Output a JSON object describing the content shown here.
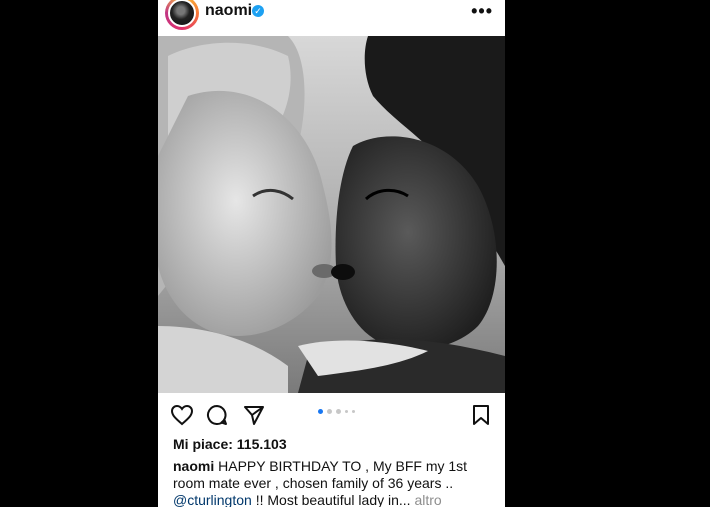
{
  "post": {
    "username": "naomi",
    "verified_icon": "verified-badge-icon",
    "more_label": "•••",
    "likes_text": "Mi piace: 115.103",
    "caption": {
      "username": "naomi",
      "text1": " HAPPY BIRTHDAY TO , My BFF  my 1st room mate ever , chosen family of 36 years .. ",
      "mention": "@cturlington",
      "text2": " !! Most beautiful lady in... ",
      "more": "altro"
    },
    "carousel": {
      "count": 5,
      "active_index": 0
    }
  },
  "colors": {
    "background": "#000000",
    "panel": "#ffffff",
    "accent_blue": "#1877f2",
    "mention": "#00376b",
    "muted": "#8e8e8e"
  }
}
